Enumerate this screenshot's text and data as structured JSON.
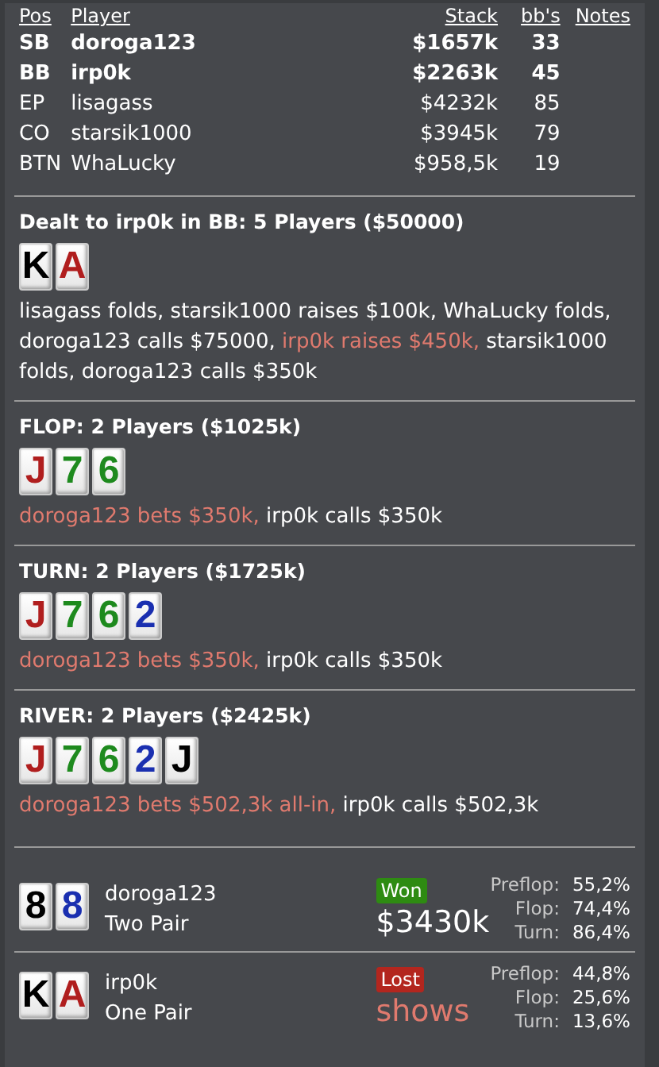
{
  "players_table": {
    "columns": [
      "Pos",
      "Player",
      "Stack",
      "bb's",
      "Notes"
    ],
    "rows": [
      {
        "pos": "SB",
        "player": "doroga123",
        "stack": "$1657k",
        "bbs": "33",
        "bold": true
      },
      {
        "pos": "BB",
        "player": "irp0k",
        "stack": "$2263k",
        "bbs": "45",
        "bold": true
      },
      {
        "pos": "EP",
        "player": "lisagass",
        "stack": "$4232k",
        "bbs": "85",
        "bold": false
      },
      {
        "pos": "CO",
        "player": "starsik1000",
        "stack": "$3945k",
        "bbs": "79",
        "bold": false
      },
      {
        "pos": "BTN",
        "player": "WhaLucky",
        "stack": "$958,5k",
        "bbs": "19",
        "bold": false
      }
    ]
  },
  "streets": [
    {
      "title": "Dealt to irp0k in BB: 5 Players ($50000)",
      "cards": [
        {
          "rank": "K",
          "color": "#000000"
        },
        {
          "rank": "A",
          "color": "#b01e1e"
        }
      ],
      "actions": [
        {
          "text": "lisagass folds, starsik1000 raises $100k, WhaLucky folds, doroga123 calls $75000, ",
          "highlight": false
        },
        {
          "text": "irp0k raises $450k,",
          "highlight": true
        },
        {
          "text": " starsik1000 folds, doroga123 calls $350k",
          "highlight": false
        }
      ]
    },
    {
      "title": "FLOP: 2 Players ($1025k)",
      "cards": [
        {
          "rank": "J",
          "color": "#b01e1e"
        },
        {
          "rank": "7",
          "color": "#1e8a1e"
        },
        {
          "rank": "6",
          "color": "#1e8a1e"
        }
      ],
      "actions": [
        {
          "text": "doroga123 bets $350k,",
          "highlight": true
        },
        {
          "text": " irp0k calls $350k",
          "highlight": false
        }
      ]
    },
    {
      "title": "TURN: 2 Players ($1725k)",
      "cards": [
        {
          "rank": "J",
          "color": "#b01e1e"
        },
        {
          "rank": "7",
          "color": "#1e8a1e"
        },
        {
          "rank": "6",
          "color": "#1e8a1e"
        },
        {
          "rank": "2",
          "color": "#1a2fb0"
        }
      ],
      "actions": [
        {
          "text": "doroga123 bets $350k,",
          "highlight": true
        },
        {
          "text": " irp0k calls $350k",
          "highlight": false
        }
      ]
    },
    {
      "title": "RIVER: 2 Players ($2425k)",
      "cards": [
        {
          "rank": "J",
          "color": "#b01e1e"
        },
        {
          "rank": "7",
          "color": "#1e8a1e"
        },
        {
          "rank": "6",
          "color": "#1e8a1e"
        },
        {
          "rank": "2",
          "color": "#1a2fb0"
        },
        {
          "rank": "J",
          "color": "#000000"
        }
      ],
      "actions": [
        {
          "text": "doroga123 bets $502,3k all-in,",
          "highlight": true
        },
        {
          "text": " irp0k calls $502,3k",
          "highlight": false
        }
      ]
    }
  ],
  "results": [
    {
      "cards": [
        {
          "rank": "8",
          "color": "#000000"
        },
        {
          "rank": "8",
          "color": "#1a2fb0"
        }
      ],
      "player": "doroga123",
      "hand": "Two Pair",
      "kind": "won",
      "badge": "Won",
      "amount": "$3430k",
      "equity": [
        {
          "label": "Preflop:",
          "value": "55,2%"
        },
        {
          "label": "Flop:",
          "value": "74,4%"
        },
        {
          "label": "Turn:",
          "value": "86,4%"
        }
      ]
    },
    {
      "cards": [
        {
          "rank": "K",
          "color": "#000000"
        },
        {
          "rank": "A",
          "color": "#b01e1e"
        }
      ],
      "player": "irp0k",
      "hand": "One Pair",
      "kind": "lost",
      "badge": "Lost",
      "amount": "shows",
      "equity": [
        {
          "label": "Preflop:",
          "value": "44,8%"
        },
        {
          "label": "Flop:",
          "value": "25,6%"
        },
        {
          "label": "Turn:",
          "value": "13,6%"
        }
      ]
    }
  ]
}
